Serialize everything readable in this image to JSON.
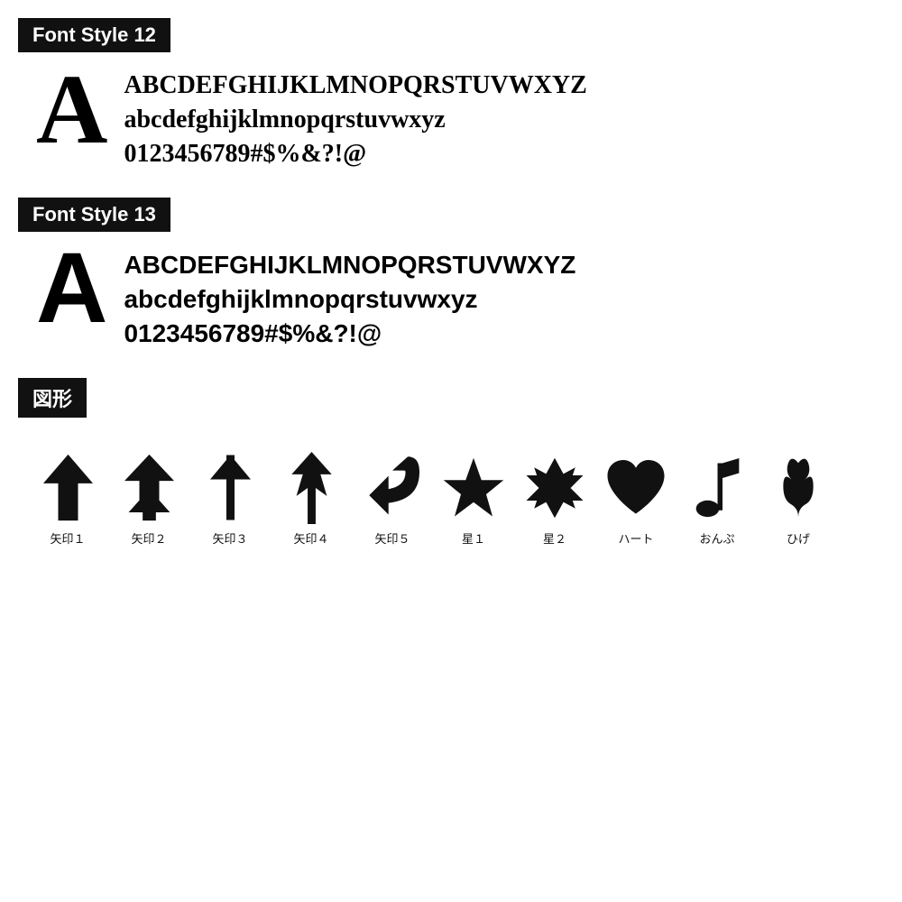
{
  "font12": {
    "label": "Font Style 12",
    "bigLetter": "A",
    "lines": [
      "ABCDEFGHIJKLMNOPQRSTUVWXYZ",
      "abcdefghijklmnopqrstuvwxyz",
      "0123456789#$%&?!@"
    ]
  },
  "font13": {
    "label": "Font Style 13",
    "bigLetter": "A",
    "lines": [
      "ABCDEFGHIJKLMNOPQRSTUVWXYZ",
      "abcdefghijklmnopqrstuvwxyz",
      "0123456789#$%&?!@"
    ]
  },
  "shapes": {
    "label": "図形",
    "items": [
      {
        "name": "矢印１",
        "type": "arrow1"
      },
      {
        "name": "矢印２",
        "type": "arrow2"
      },
      {
        "name": "矢印３",
        "type": "arrow3"
      },
      {
        "name": "矢印４",
        "type": "arrow4"
      },
      {
        "name": "矢印５",
        "type": "arrow5"
      },
      {
        "name": "星１",
        "type": "star1"
      },
      {
        "name": "星２",
        "type": "star2"
      },
      {
        "name": "ハート",
        "type": "heart"
      },
      {
        "name": "おんぷ",
        "type": "note"
      },
      {
        "name": "ひげ",
        "type": "mustache"
      }
    ]
  }
}
